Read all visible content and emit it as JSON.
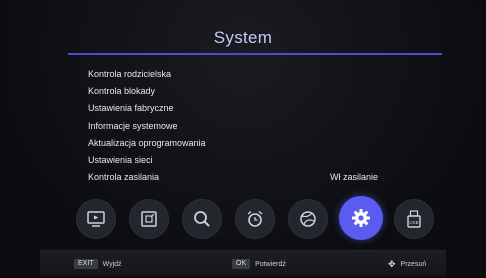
{
  "header": {
    "title": "System"
  },
  "menu": {
    "items": [
      {
        "label": "Kontrola rodzicielska",
        "value": ""
      },
      {
        "label": "Kontrola blokady",
        "value": ""
      },
      {
        "label": "Ustawienia fabryczne",
        "value": ""
      },
      {
        "label": "Informacje systemowe",
        "value": ""
      },
      {
        "label": "Aktualizacja oprogramowania",
        "value": ""
      },
      {
        "label": "Ustawienia sieci",
        "value": ""
      },
      {
        "label": "Kontrola zasilania",
        "value": "Wł zasilanie"
      }
    ]
  },
  "icons": [
    {
      "name": "tv-icon",
      "active": false
    },
    {
      "name": "picture-icon",
      "active": false
    },
    {
      "name": "search-icon",
      "active": false
    },
    {
      "name": "alarm-clock-icon",
      "active": false
    },
    {
      "name": "ball-icon",
      "active": false
    },
    {
      "name": "gear-icon",
      "active": true
    },
    {
      "name": "usb-icon",
      "active": false
    }
  ],
  "footer": {
    "exit_key": "EXIT",
    "exit_label": "Wyjdź",
    "ok_key": "OK",
    "ok_label": "Potwierdź",
    "move_label": "Przesuń"
  },
  "colors": {
    "accent": "#5a5cf0",
    "title_rule": "#4b4ed1",
    "background": "#0c0d10"
  }
}
